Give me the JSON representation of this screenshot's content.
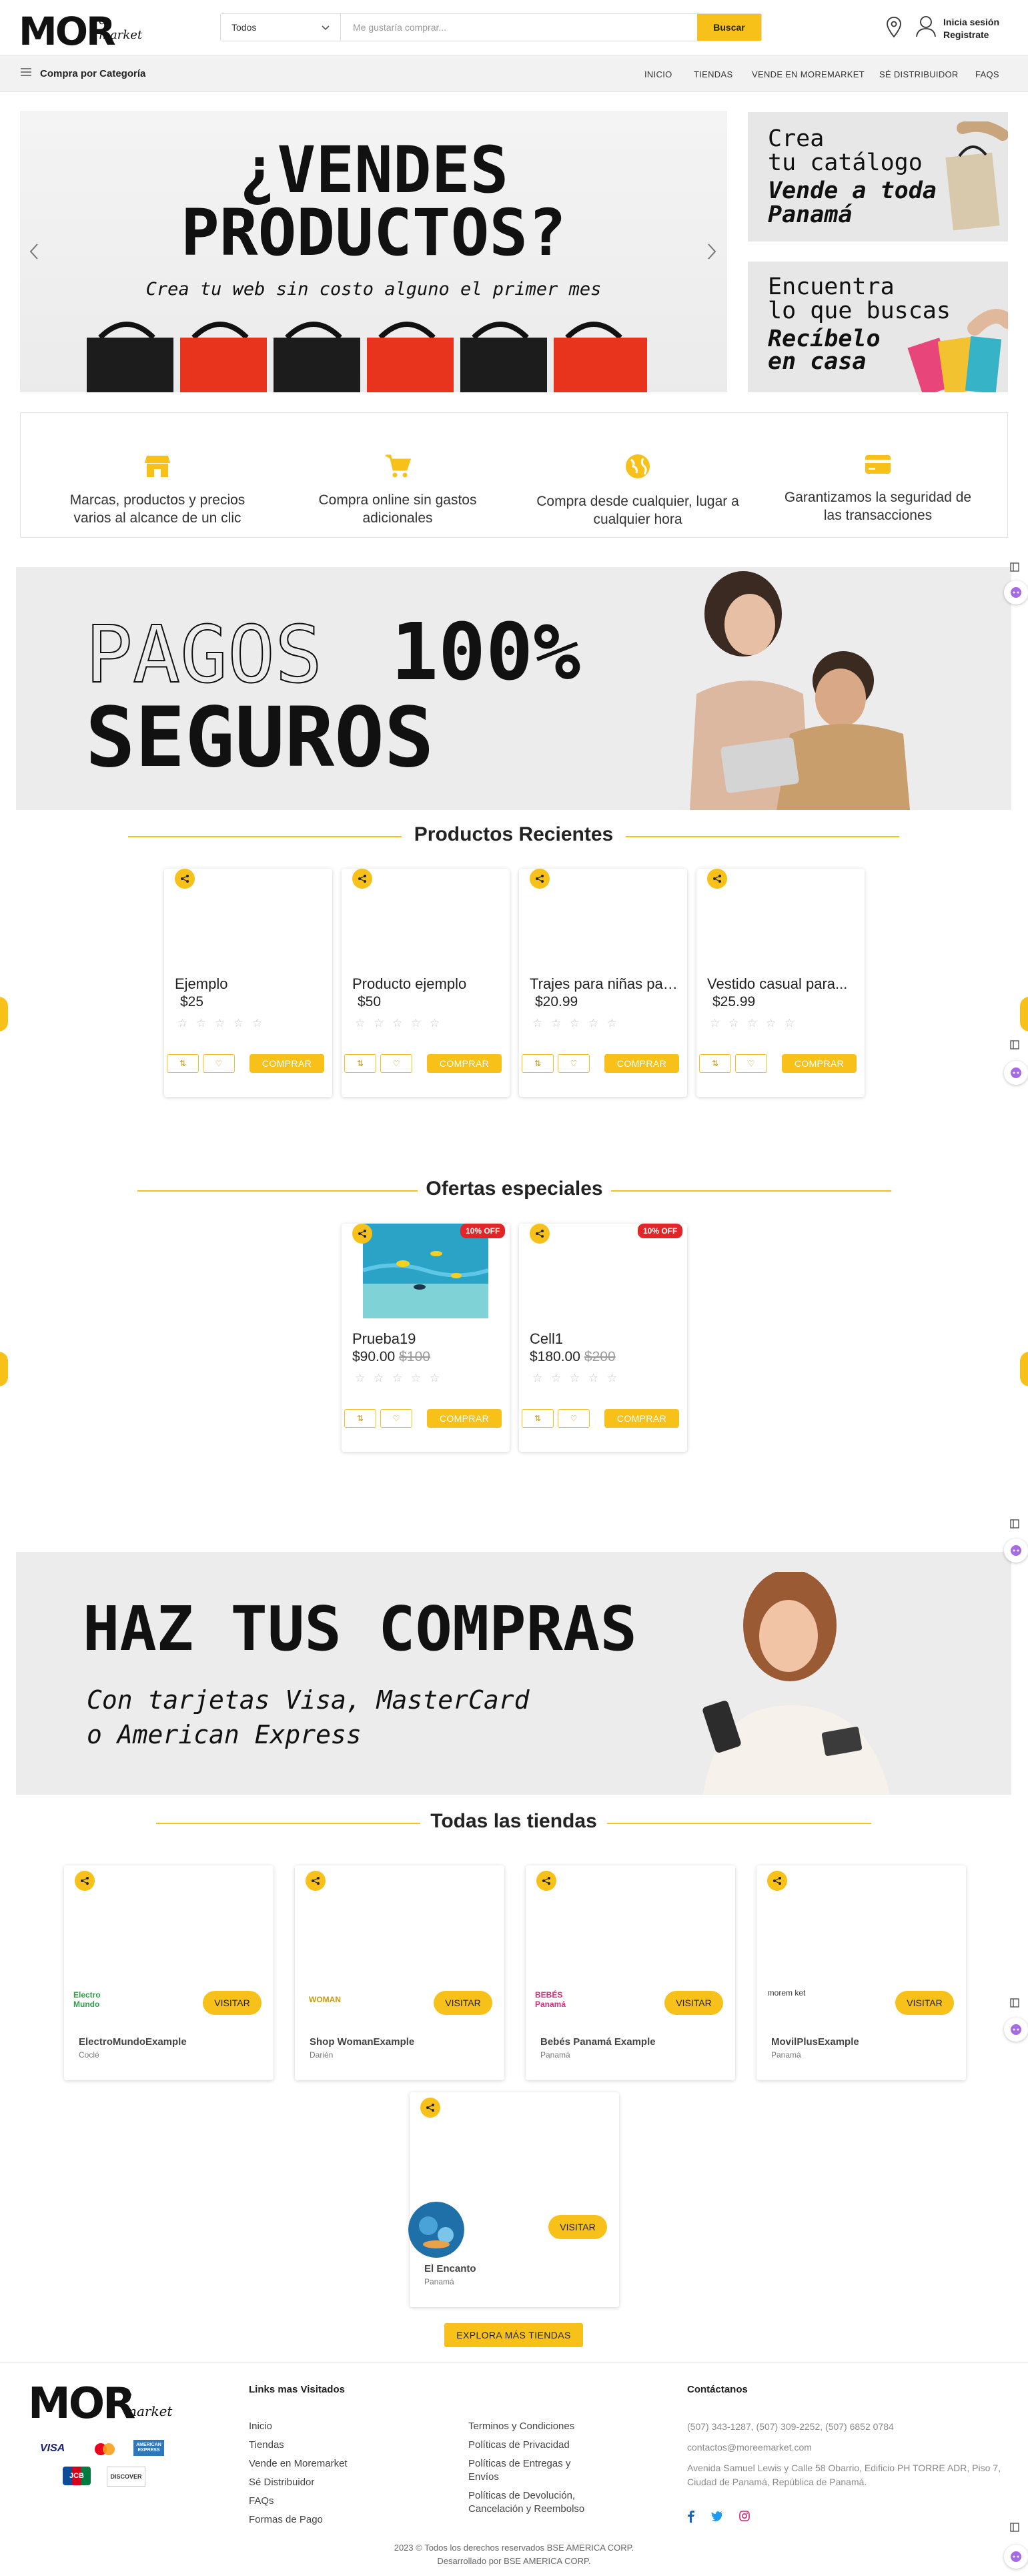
{
  "header": {
    "logo_main": "MOR",
    "logo_sub_top": "e",
    "logo_sub_bottom": "market",
    "category_select": "Todos",
    "search_placeholder": "Me gustaría comprar...",
    "search_button": "Buscar",
    "login_line1": "Inicia sesión",
    "login_line2": "Registrate"
  },
  "nav": {
    "category_button": "Compra por Categoría",
    "links": [
      "INICIO",
      "TIENDAS",
      "VENDE EN MOREMARKET",
      "SÉ DISTRIBUIDOR",
      "FAQS"
    ]
  },
  "hero": {
    "title_line1": "¿VENDES",
    "title_line2": "PRODUCTOS?",
    "subtitle": "Crea tu web sin costo alguno el primer mes",
    "side1_line1": "Crea",
    "side1_line2": "tu catálogo",
    "side1_line3": "Vende a toda",
    "side1_line4": "Panamá",
    "side2_line1": "Encuentra",
    "side2_line2": "lo que buscas",
    "side2_line3": "Recíbelo",
    "side2_line4": "en casa"
  },
  "features": [
    {
      "icon": "store-icon",
      "text": "Marcas, productos y precios varios al alcance de un clic"
    },
    {
      "icon": "cart-icon",
      "text": "Compra online sin gastos adicionales"
    },
    {
      "icon": "globe-icon",
      "text": "Compra desde cualquier, lugar a cualquier hora"
    },
    {
      "icon": "card-icon",
      "text": "Garantizamos la seguridad de las transacciones"
    }
  ],
  "banner_pagos": {
    "word1": "PAGOS",
    "word2": "100%",
    "word3": "SEGUROS"
  },
  "recent": {
    "title": "Productos Recientes",
    "items": [
      {
        "name": "Ejemplo",
        "price": "$25"
      },
      {
        "name": "Producto ejemplo",
        "price": "$50"
      },
      {
        "name": "Trajes para niñas para...",
        "price": "$20.99"
      },
      {
        "name": "Vestido casual para...",
        "price": "$25.99"
      }
    ]
  },
  "offers": {
    "title": "Ofertas especiales",
    "items": [
      {
        "name": "Prueba19",
        "price": "$90.00",
        "old_price": "$100",
        "badge": "10% OFF"
      },
      {
        "name": "Cell1",
        "price": "$180.00",
        "old_price": "$200",
        "badge": "10% OFF"
      }
    ]
  },
  "card_labels": {
    "buy": "COMPRAR",
    "stars": "☆ ☆ ☆ ☆ ☆"
  },
  "banner_compras": {
    "title": "HAZ TUS COMPRAS",
    "line1": "Con tarjetas Visa, MasterCard",
    "line2": "o American Express"
  },
  "stores": {
    "title": "Todas las tiendas",
    "visit_label": "VISITAR",
    "items": [
      {
        "name": "ElectroMundoExample",
        "province": "Coclé",
        "logo": "Electro Mundo"
      },
      {
        "name": "Shop WomanExample",
        "province": "Darién",
        "logo": "WOMAN"
      },
      {
        "name": "Bebés Panamá Example",
        "province": "Panamá",
        "logo": "BEBÉS Panamá"
      },
      {
        "name": "MovilPlusExample",
        "province": "Panamá",
        "logo": "morem ket"
      },
      {
        "name": "El Encanto",
        "province": "Panamá",
        "logo": ""
      }
    ],
    "explore_button": "EXPLORA MÁS TIENDAS"
  },
  "footer": {
    "links_title": "Links mas Visitados",
    "links_col1": [
      "Inicio",
      "Tiendas",
      "Vende en Moremarket",
      "Sé Distribuidor",
      "FAQs",
      "Formas de Pago"
    ],
    "links_col2": [
      "Terminos y Condiciones",
      "Políticas de Privacidad",
      "Políticas de Entregas y Envíos",
      "Políticas de Devolución, Cancelación y Reembolso"
    ],
    "contact_title": "Contáctanos",
    "phones": "(507) 343-1287, (507) 309-2252, (507) 6852 0784",
    "email": "contactos@moreemarket.com",
    "address": "Avenida Samuel Lewis y Calle 58 Obarrio, Edificio PH TORRE ADR, Piso 7, Ciudad de Panamá, República de Panamá.",
    "copyright": "2023 © Todos los derechos reservados BSE AMERICA CORP.",
    "developed": "Desarrollado por BSE AMERICA CORP.",
    "cards": [
      "VISA",
      "mastercard",
      "AMERICAN EXPRESS",
      "JCB",
      "DISCOVER"
    ]
  },
  "colors": {
    "accent": "#f7c11a",
    "badge": "#e02626"
  }
}
